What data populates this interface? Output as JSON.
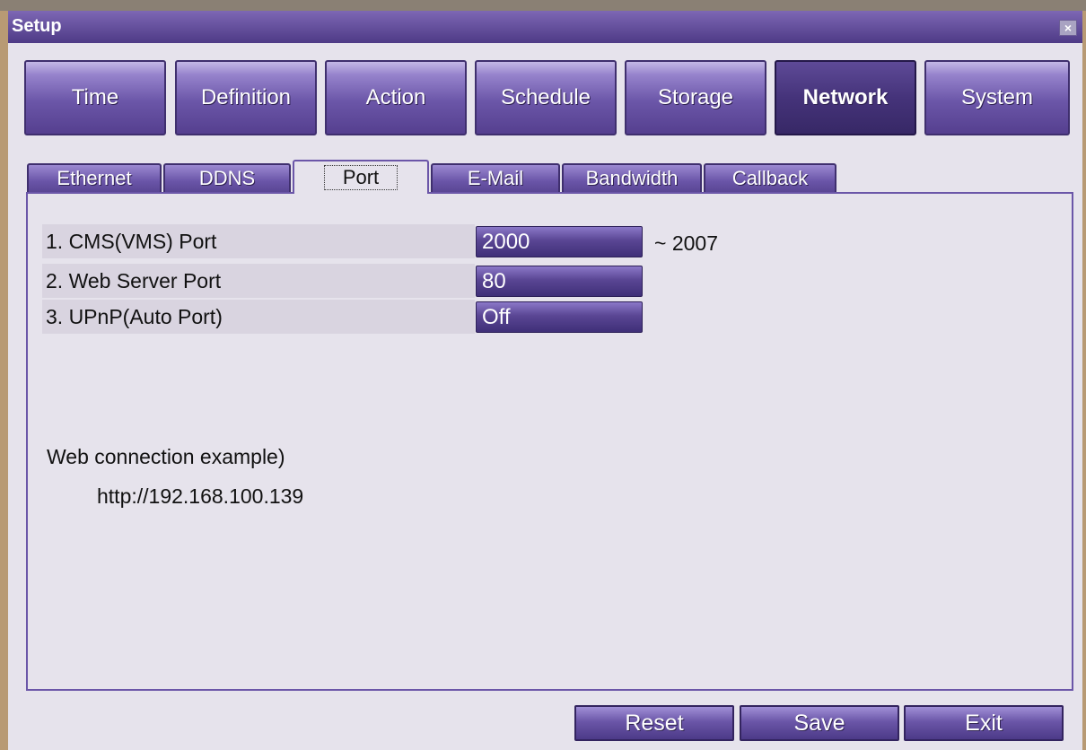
{
  "window": {
    "title": "Setup",
    "close_glyph": "×"
  },
  "main_tabs": [
    {
      "label": "Time",
      "active": false
    },
    {
      "label": "Definition",
      "active": false
    },
    {
      "label": "Action",
      "active": false
    },
    {
      "label": "Schedule",
      "active": false
    },
    {
      "label": "Storage",
      "active": false
    },
    {
      "label": "Network",
      "active": true
    },
    {
      "label": "System",
      "active": false
    }
  ],
  "sub_tabs": [
    {
      "label": "Ethernet",
      "active": false
    },
    {
      "label": "DDNS",
      "active": false
    },
    {
      "label": "Port",
      "active": true
    },
    {
      "label": "E-Mail",
      "active": false
    },
    {
      "label": "Bandwidth",
      "active": false
    },
    {
      "label": "Callback",
      "active": false
    }
  ],
  "port_settings": [
    {
      "label": "1. CMS(VMS) Port",
      "value": "2000",
      "suffix": "~ 2007"
    },
    {
      "label": "2. Web Server Port",
      "value": "80"
    },
    {
      "label": "3. UPnP(Auto Port)",
      "value": "Off"
    }
  ],
  "example": {
    "title": "Web connection example)",
    "url": "http://192.168.100.139"
  },
  "footer": {
    "reset_label": "Reset",
    "save_label": "Save",
    "exit_label": "Exit"
  },
  "colors": {
    "accent": "#5a4694",
    "active_tab": "#372866",
    "panel_bg": "#e6e3ec"
  }
}
